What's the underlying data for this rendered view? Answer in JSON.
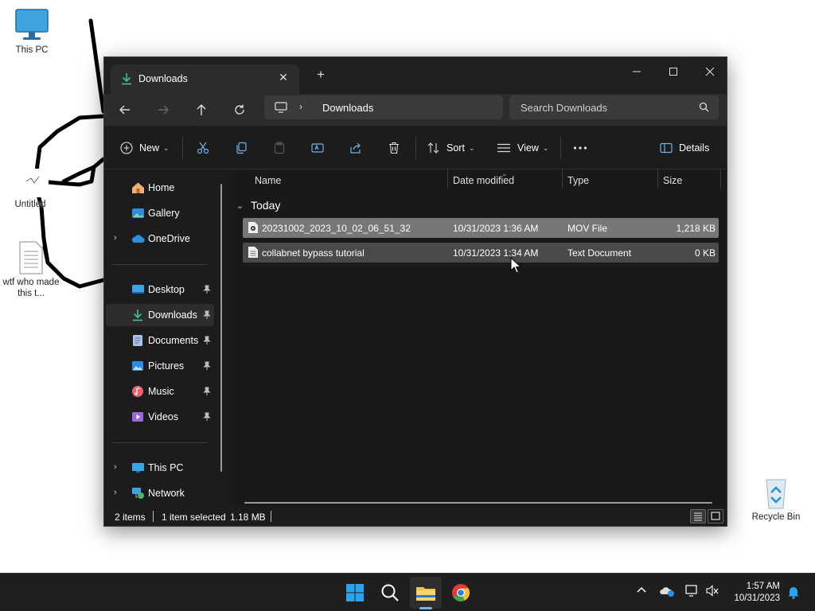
{
  "desktop": {
    "icons": [
      {
        "label": "This PC"
      },
      {
        "label": "Untitled"
      },
      {
        "label": "wtf who made this t..."
      },
      {
        "label": "Recycle Bin"
      }
    ]
  },
  "window": {
    "tab_title": "Downloads",
    "address": {
      "crumb": "Downloads"
    },
    "search": {
      "placeholder": "Search Downloads"
    },
    "toolbar": {
      "new_label": "New",
      "sort_label": "Sort",
      "view_label": "View",
      "details_label": "Details"
    },
    "nav": {
      "items": [
        {
          "label": "Home"
        },
        {
          "label": "Gallery"
        },
        {
          "label": "OneDrive"
        },
        {
          "label": "Desktop"
        },
        {
          "label": "Downloads"
        },
        {
          "label": "Documents"
        },
        {
          "label": "Pictures"
        },
        {
          "label": "Music"
        },
        {
          "label": "Videos"
        },
        {
          "label": "This PC"
        },
        {
          "label": "Network"
        }
      ],
      "selected": "Downloads"
    },
    "columns": {
      "name": "Name",
      "date": "Date modified",
      "type": "Type",
      "size": "Size"
    },
    "group": "Today",
    "files": [
      {
        "name": "20231002_2023_10_02_06_51_32",
        "date": "10/31/2023 1:36 AM",
        "type": "MOV File",
        "size": "1,218 KB"
      },
      {
        "name": "collabnet bypass tutorial",
        "date": "10/31/2023 1:34 AM",
        "type": "Text Document",
        "size": "0 KB"
      }
    ],
    "status": {
      "items": "2 items",
      "selected": "1 item selected",
      "size": "1.18 MB"
    }
  },
  "taskbar": {
    "time": "1:57 AM",
    "date": "10/31/2023"
  },
  "colors": {
    "accent": "#6cb8f0",
    "window_bg": "#1c1c1c",
    "selected_row": "#777777"
  }
}
